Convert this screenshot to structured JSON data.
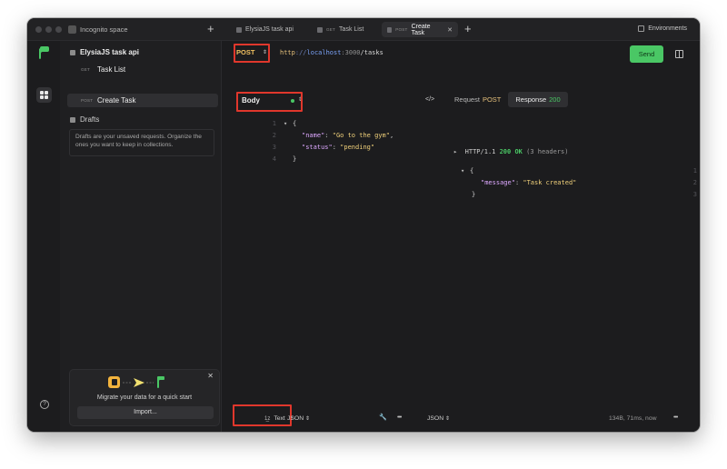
{
  "titlebar": {
    "space_label": "Incognito space",
    "tabs": [
      {
        "label": "ElysiaJS task api",
        "method": ""
      },
      {
        "label": "Task List",
        "method": "GET"
      },
      {
        "label": "Create Task",
        "method": "POST"
      }
    ],
    "environments_label": "Environments"
  },
  "sidebar": {
    "collection_name": "ElysiaJS task api",
    "requests": [
      {
        "method": "GET",
        "name": "Task List"
      },
      {
        "method": "POST",
        "name": "Create Task"
      }
    ],
    "drafts_title": "Drafts",
    "drafts_hint": "Drafts are your unsaved requests. Organize the ones you want to keep in collections.",
    "migrate_text": "Migrate your data for a quick start",
    "import_label": "Import..."
  },
  "request": {
    "method": "POST",
    "url_proto": "http",
    "url_slash": "://",
    "url_host": "localhost",
    "url_port": ":3000",
    "url_path": "/tasks",
    "send_label": "Send",
    "body_tab": "Body",
    "body_lines": [
      {
        "n": "1",
        "t": "{"
      },
      {
        "n": "2",
        "k": "\"name\"",
        "v": "\"Go to the gym\"",
        "end": ","
      },
      {
        "n": "3",
        "k": "\"status\"",
        "v": "\"pending\"",
        "end": ""
      },
      {
        "n": "4",
        "t": "}"
      }
    ],
    "format_label": "Text",
    "body_format": "JSON"
  },
  "response": {
    "tab_request_label": "Request",
    "tab_request_method": "POST",
    "tab_response_label": "Response",
    "tab_response_code": "200",
    "status_proto": "HTTP/1.1",
    "status_code": "200 OK",
    "status_headers": "(3 headers)",
    "json_key": "\"message\"",
    "json_value": "\"Task created\"",
    "line_numbers": [
      "1",
      "2",
      "3"
    ],
    "format": "JSON",
    "meta": "134B, 71ms, now"
  },
  "icons": [
    "incognito-icon",
    "plus-icon",
    "collection-icon",
    "close-icon",
    "environments-icon",
    "logo-icon",
    "collections-grid-icon",
    "help-icon",
    "avatar-icon",
    "drafts-icon",
    "layout-icon",
    "code-icon",
    "wrench-icon",
    "more-icon"
  ],
  "colors": {
    "accent_green": "#4ac765",
    "method_post": "#f0c060",
    "highlight_red": "#e0372c"
  }
}
